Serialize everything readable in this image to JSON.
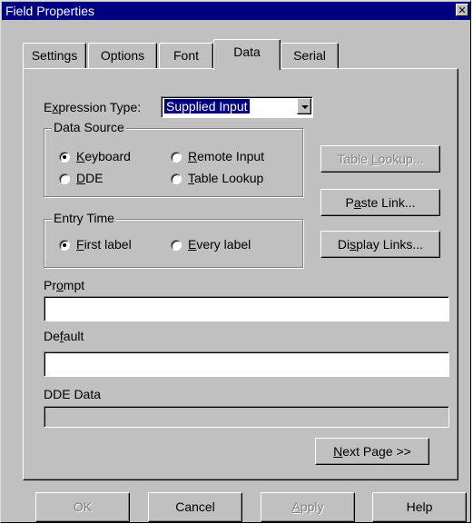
{
  "window": {
    "title": "Field Properties",
    "close_glyph": "✕"
  },
  "tabs": [
    {
      "label": "Settings"
    },
    {
      "label": "Options"
    },
    {
      "label": "Font"
    },
    {
      "label": "Data",
      "active": true
    },
    {
      "label": "Serial"
    }
  ],
  "expression_type": {
    "label_pre": "E",
    "label_mn": "x",
    "label_post": "pression Type:",
    "value": "Supplied Input"
  },
  "data_source": {
    "legend": "Data Source",
    "options": [
      {
        "pre": "",
        "mn": "K",
        "post": "eyboard",
        "selected": true
      },
      {
        "pre": "",
        "mn": "R",
        "post": "emote Input",
        "selected": false
      },
      {
        "pre": "",
        "mn": "D",
        "post": "DE",
        "selected": false
      },
      {
        "pre": "",
        "mn": "T",
        "post": "able Lookup",
        "selected": false
      }
    ]
  },
  "entry_time": {
    "legend": "Entry Time",
    "options": [
      {
        "pre": "",
        "mn": "F",
        "post": "irst label",
        "selected": true
      },
      {
        "pre": "",
        "mn": "E",
        "post": "very label",
        "selected": false
      }
    ]
  },
  "side_buttons": {
    "table_lookup": {
      "pre": "Table ",
      "mn": "L",
      "post": "ookup...",
      "enabled": false
    },
    "paste_link": {
      "pre": "P",
      "mn": "a",
      "post": "ste Link...",
      "enabled": true
    },
    "display_links": {
      "pre": "Di",
      "mn": "s",
      "post": "play Links...",
      "enabled": true
    }
  },
  "prompt": {
    "pre": "Pr",
    "mn": "o",
    "post": "mpt",
    "value": ""
  },
  "default": {
    "pre": "De",
    "mn": "f",
    "post": "ault",
    "value": ""
  },
  "dde_data": {
    "label": "DDE Data",
    "value": ""
  },
  "next_page": {
    "pre": "",
    "mn": "N",
    "post": "ext Page >>"
  },
  "footer": {
    "ok": "OK",
    "cancel": "Cancel",
    "apply_pre": "",
    "apply_mn": "A",
    "apply_post": "pply",
    "help": "Help"
  }
}
